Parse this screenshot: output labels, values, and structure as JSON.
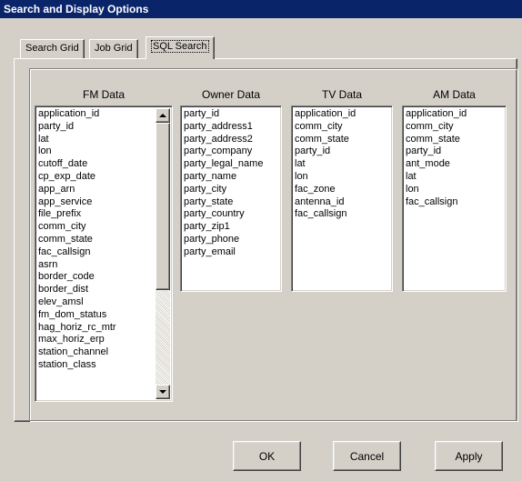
{
  "window": {
    "title": "Search and Display Options"
  },
  "tabs": [
    {
      "label": "Search Grid",
      "active": false
    },
    {
      "label": "Job Grid",
      "active": false
    },
    {
      "label": "SQL Search",
      "active": true
    }
  ],
  "columns": {
    "fm": {
      "label": "FM Data",
      "items": [
        "application_id",
        "party_id",
        "lat",
        "lon",
        "cutoff_date",
        "cp_exp_date",
        "app_arn",
        "app_service",
        "file_prefix",
        "comm_city",
        "comm_state",
        "fac_callsign",
        "asrn",
        "border_code",
        "border_dist",
        "elev_amsl",
        "fm_dom_status",
        "hag_horiz_rc_mtr",
        "max_horiz_erp",
        "station_channel",
        "station_class"
      ]
    },
    "owner": {
      "label": "Owner Data",
      "items": [
        "party_id",
        "party_address1",
        "party_address2",
        "party_company",
        "party_legal_name",
        "party_name",
        "party_city",
        "party_state",
        "party_country",
        "party_zip1",
        "party_phone",
        "party_email"
      ]
    },
    "tv": {
      "label": "TV Data",
      "items": [
        "application_id",
        "comm_city",
        "comm_state",
        "party_id",
        "lat",
        "lon",
        "fac_zone",
        "antenna_id",
        "fac_callsign"
      ]
    },
    "am": {
      "label": "AM Data",
      "items": [
        "application_id",
        "comm_city",
        "comm_state",
        "party_id",
        "ant_mode",
        "lat",
        "lon",
        "fac_callsign"
      ]
    }
  },
  "buttons": {
    "ok": "OK",
    "cancel": "Cancel",
    "apply": "Apply"
  }
}
